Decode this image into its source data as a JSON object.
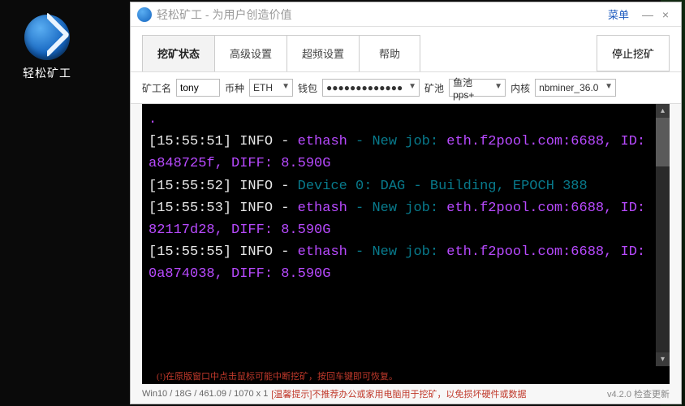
{
  "desktop": {
    "icon_label": "轻松矿工"
  },
  "window": {
    "title": "轻松矿工 - 为用户创造价值",
    "menu": "菜单",
    "minimize": "—",
    "close": "×"
  },
  "tabs": {
    "status": "挖矿状态",
    "advanced": "高级设置",
    "overclock": "超频设置",
    "help": "帮助",
    "stop": "停止挖矿"
  },
  "form": {
    "miner_label": "矿工名",
    "miner_value": "tony",
    "coin_label": "币种",
    "coin_value": "ETH",
    "wallet_label": "钱包",
    "wallet_value": "●●●●●●●●●●●●●",
    "pool_label": "矿池",
    "pool_value": "鱼池pps+",
    "kernel_label": "内核",
    "kernel_value": "nbminer_36.0"
  },
  "log": {
    "l1a": "[15:55:51] INFO - ",
    "l1b": "ethash",
    "l1c": " - New job: ",
    "l1d": "eth.f2pool.com:6688, ID: a848725f, DIFF: 8.590G",
    "l2a": "[15:55:52] INFO - ",
    "l2b": "Device 0: DAG - Building, EPOCH 388",
    "l3a": "[15:55:53] INFO - ",
    "l3b": "ethash",
    "l3c": " - New job: ",
    "l3d": "eth.f2pool.com:6688, ID: 82117d28, DIFF: 8.590G",
    "l4a": "[15:55:55] INFO - ",
    "l4b": "ethash",
    "l4c": " - New job: ",
    "l4d": "eth.f2pool.com:6688, ID: 0a874038, DIFF: 8.590G"
  },
  "hint": "(!)在原版窗口中点击鼠标可能中断挖矿，按回车键即可恢复。",
  "status": {
    "sys": "Win10 / 18G / 461.09 / 1070 x 1",
    "warn": "[温馨提示]不推荐办公或家用电脑用于挖矿，以免损坏硬件或数据",
    "version": "v4.2.0 检查更新"
  }
}
